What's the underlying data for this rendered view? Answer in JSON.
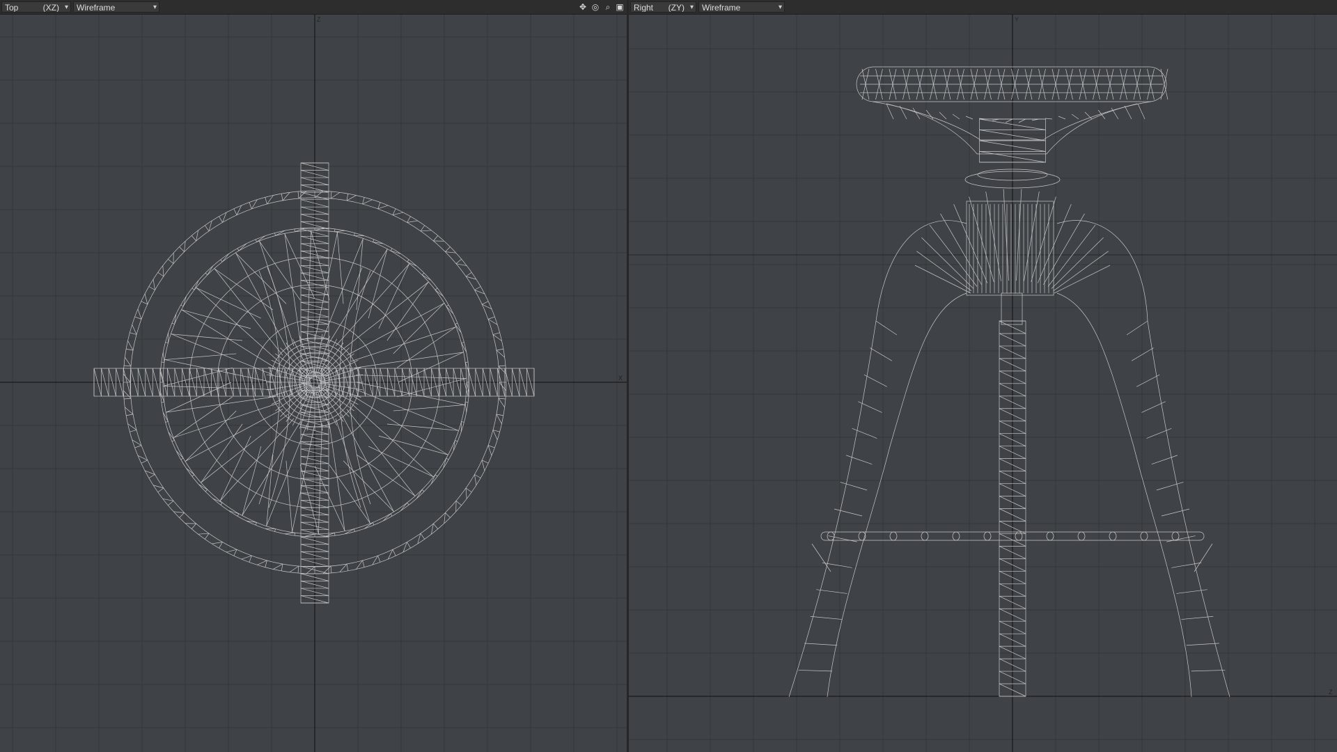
{
  "viewports": {
    "left": {
      "view": "Top",
      "axes": "(XZ)",
      "render_mode": "Wireframe",
      "axis_label_h": "X",
      "axis_label_v": "Z"
    },
    "right": {
      "view": "Right",
      "axes": "(ZY)",
      "render_mode": "Wireframe",
      "axis_label_h": "Z",
      "axis_label_v": "Y"
    }
  },
  "header_icons": [
    "move-view-icon",
    "rotate-view-icon",
    "zoom-view-icon",
    "maximize-view-icon"
  ],
  "colors": {
    "viewport_bg": "#3f4347",
    "grid": "#33373a",
    "axis": "#1a1a1a",
    "wire": "#c8c8c8"
  }
}
